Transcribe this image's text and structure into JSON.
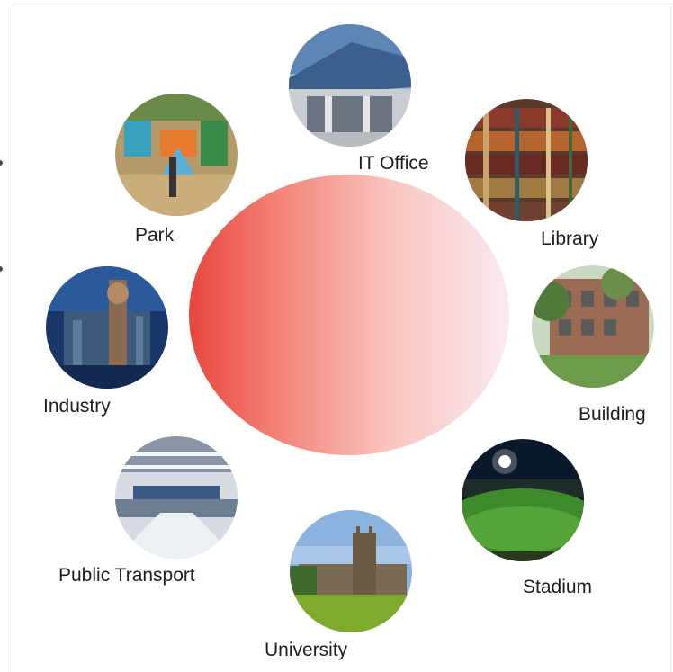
{
  "center_color_start": "#e8463e",
  "center_color_end": "#f9eaf1",
  "nodes": {
    "it_office": {
      "label": "IT Office",
      "icon": "office-building-photo"
    },
    "library": {
      "label": "Library",
      "icon": "bookshelf-photo"
    },
    "building": {
      "label": "Building",
      "icon": "apartment-photo"
    },
    "stadium": {
      "label": "Stadium",
      "icon": "stadium-photo"
    },
    "university": {
      "label": "University",
      "icon": "university-photo"
    },
    "public_transport": {
      "label": "Public Transport",
      "icon": "train-station-photo"
    },
    "industry": {
      "label": "Industry",
      "icon": "factory-photo"
    },
    "park": {
      "label": "Park",
      "icon": "playground-photo"
    }
  }
}
